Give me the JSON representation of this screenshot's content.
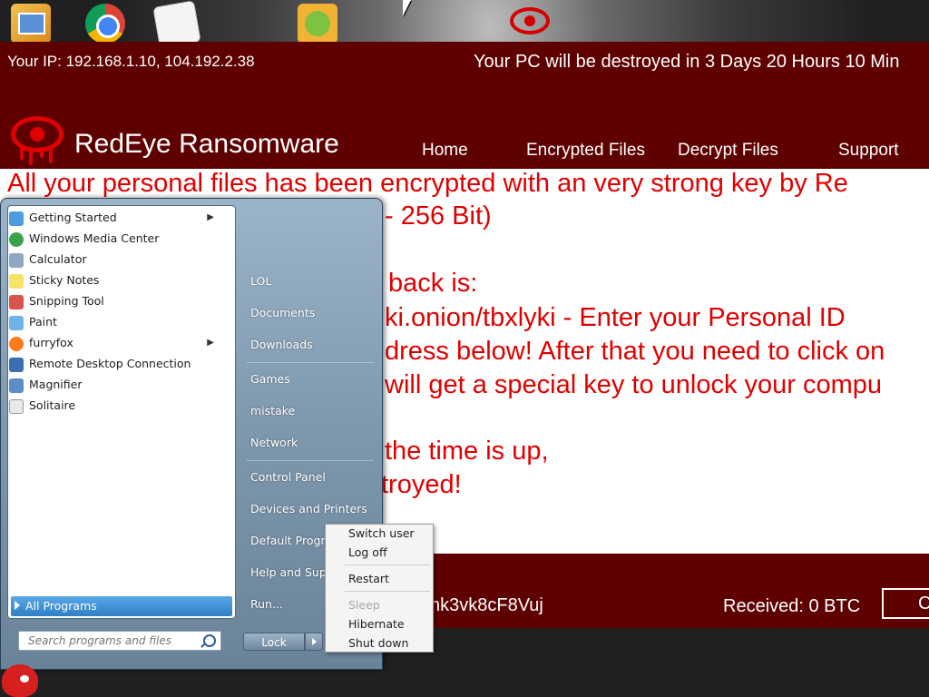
{
  "desktop": {
    "icons": [
      "app-icon",
      "chrome-icon",
      "document-icon",
      "bad-piggies-icon"
    ]
  },
  "ransomware": {
    "ip_line": "Your IP: 192.168.1.10, 104.192.2.38",
    "timer_line": "Your PC will be destroyed in 3 Days 20 Hours 10 Min",
    "brand": "RedEye Ransomware",
    "nav": [
      "Home",
      "Encrypted Files",
      "Decrypt Files",
      "Support"
    ],
    "message_lines": [
      "All your personal files has been encrypted with an very strong key by Re",
      "- 256 Bit)",
      "back is:",
      "ki.onion/tbxlyki - Enter your Personal ID",
      "dress below! After that you need to click on",
      "will get a special key to unlock your compu",
      "the time is up,",
      "troyed!"
    ],
    "wallet_fragment": "nk3vk8cF8Vuj",
    "received": "Received: 0 BTC",
    "button_fragment": "C",
    "colors": {
      "header_bg": "#5e0000",
      "text_red": "#e00000"
    }
  },
  "start_menu": {
    "programs": [
      {
        "label": "Getting Started",
        "icon": "getting-started-icon",
        "submenu": true
      },
      {
        "label": "Windows Media Center",
        "icon": "media-center-icon",
        "submenu": false
      },
      {
        "label": "Calculator",
        "icon": "calculator-icon",
        "submenu": false
      },
      {
        "label": "Sticky Notes",
        "icon": "sticky-notes-icon",
        "submenu": false
      },
      {
        "label": "Snipping Tool",
        "icon": "snipping-tool-icon",
        "submenu": false
      },
      {
        "label": "Paint",
        "icon": "paint-icon",
        "submenu": false
      },
      {
        "label": "furryfox",
        "icon": "firefox-icon",
        "submenu": true
      },
      {
        "label": "Remote Desktop Connection",
        "icon": "remote-desktop-icon",
        "submenu": false
      },
      {
        "label": "Magnifier",
        "icon": "magnifier-icon",
        "submenu": false
      },
      {
        "label": "Solitaire",
        "icon": "solitaire-icon",
        "submenu": false
      }
    ],
    "all_programs": "All Programs",
    "search_placeholder": "Search programs and files",
    "right_items": [
      "LOL",
      "Documents",
      "Downloads",
      "Games",
      "mistake",
      "Network",
      "Control Panel",
      "Devices and Printers",
      "Default Progra",
      "Help and Supp",
      "Run..."
    ],
    "lock_label": "Lock",
    "power_menu": {
      "items": [
        {
          "label": "Switch user",
          "enabled": true
        },
        {
          "label": "Log off",
          "enabled": true
        },
        {
          "label": "Restart",
          "enabled": true
        },
        {
          "label": "Sleep",
          "enabled": false
        },
        {
          "label": "Hibernate",
          "enabled": true
        },
        {
          "label": "Shut down",
          "enabled": true
        }
      ]
    }
  }
}
